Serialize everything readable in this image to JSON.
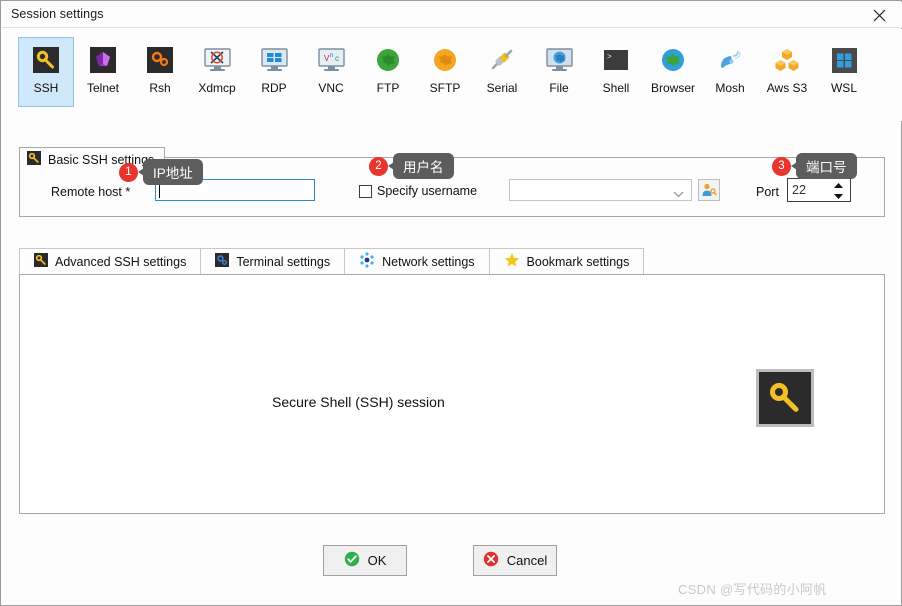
{
  "window": {
    "title": "Session settings",
    "close_label": "×"
  },
  "session_types": [
    {
      "label": "SSH",
      "icon": "key-icon",
      "selected": true
    },
    {
      "label": "Telnet",
      "icon": "telnet-icon",
      "selected": false
    },
    {
      "label": "Rsh",
      "icon": "rsh-icon",
      "selected": false
    },
    {
      "label": "Xdmcp",
      "icon": "xdmcp-icon",
      "selected": false
    },
    {
      "label": "RDP",
      "icon": "rdp-icon",
      "selected": false
    },
    {
      "label": "VNC",
      "icon": "vnc-icon",
      "selected": false
    },
    {
      "label": "FTP",
      "icon": "ftp-globe-icon",
      "selected": false
    },
    {
      "label": "SFTP",
      "icon": "sftp-globe-icon",
      "selected": false
    },
    {
      "label": "Serial",
      "icon": "serial-plug-icon",
      "selected": false
    },
    {
      "label": "File",
      "icon": "file-share-icon",
      "selected": false
    },
    {
      "label": "Shell",
      "icon": "shell-icon",
      "selected": false
    },
    {
      "label": "Browser",
      "icon": "browser-icon",
      "selected": false
    },
    {
      "label": "Mosh",
      "icon": "satellite-icon",
      "selected": false
    },
    {
      "label": "Aws S3",
      "icon": "aws-s3-icon",
      "selected": false
    },
    {
      "label": "WSL",
      "icon": "windows-icon",
      "selected": false
    }
  ],
  "basic_group": {
    "title": "Basic SSH settings",
    "remote_host_label": "Remote host *",
    "remote_host_value": "",
    "specify_username_label": "Specify username",
    "specify_username_checked": false,
    "username_value": "",
    "port_label": "Port",
    "port_value": "22"
  },
  "settings_tabs": [
    {
      "label": "Advanced SSH settings",
      "icon": "key-icon"
    },
    {
      "label": "Terminal settings",
      "icon": "gears-icon"
    },
    {
      "label": "Network settings",
      "icon": "network-dots-icon"
    },
    {
      "label": "Bookmark settings",
      "icon": "star-icon"
    }
  ],
  "panel": {
    "description": "Secure Shell (SSH) session",
    "icon": "key-icon"
  },
  "footer": {
    "ok_label": "OK",
    "cancel_label": "Cancel"
  },
  "annotations": [
    {
      "number": "1",
      "text": "IP地址"
    },
    {
      "number": "2",
      "text": "用户名"
    },
    {
      "number": "3",
      "text": "端口号"
    }
  ],
  "watermark": "CSDN @写代码的小阿帆",
  "colors": {
    "selection": "#cfe8fa",
    "focus_border": "#2d8bd4",
    "badge_red": "#e8352e",
    "bubble_gray": "#5d5d5d",
    "ok_green": "#2faf4a",
    "cancel_red": "#e03030"
  }
}
